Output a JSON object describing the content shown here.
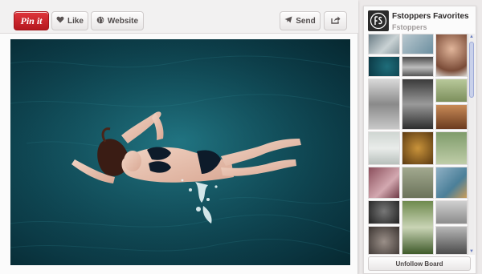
{
  "toolbar": {
    "pin_label": "Pin it",
    "like_label": "Like",
    "website_label": "Website",
    "send_label": "Send"
  },
  "board": {
    "title": "Fstoppers Favorites",
    "owner": "Fstoppers",
    "unfollow_label": "Unfollow Board"
  },
  "colors": {
    "pin_red": "#c81c23",
    "water_teal": "#12505c",
    "scroll_accent": "#6b7fc2"
  },
  "icons": {
    "like": "heart-icon",
    "website": "globe-icon",
    "send": "paper-plane-icon",
    "share": "share-arrow-icon"
  }
}
